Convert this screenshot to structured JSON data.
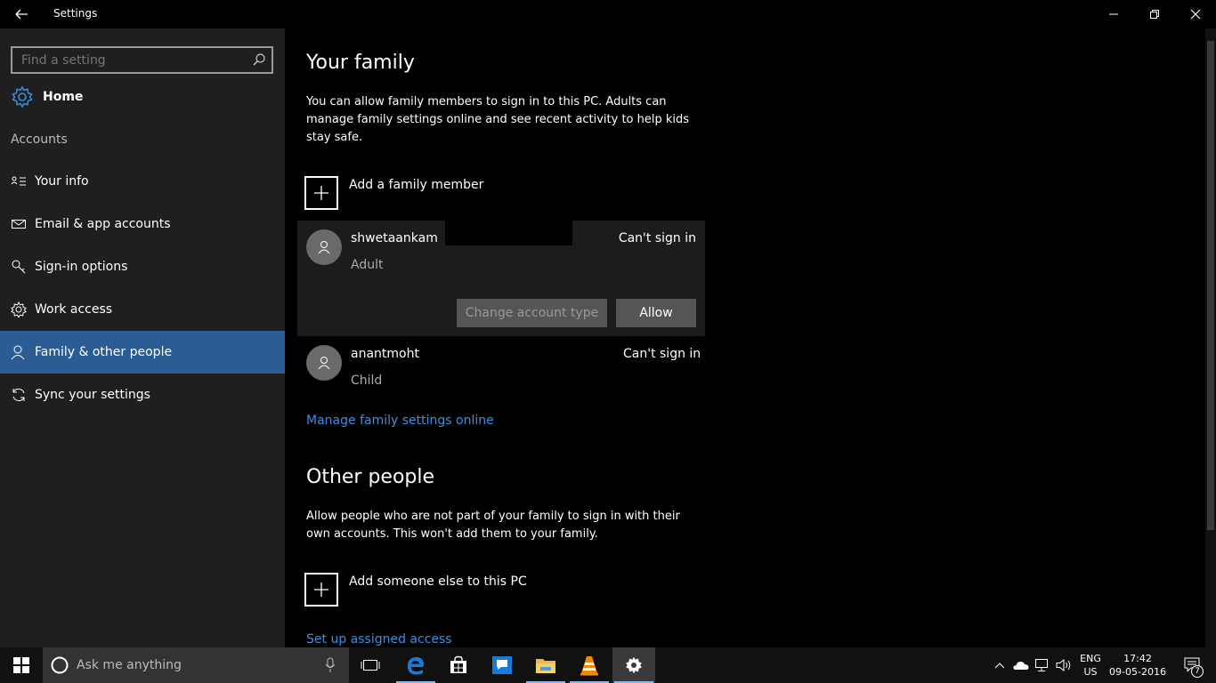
{
  "window": {
    "title": "Settings"
  },
  "sidebar": {
    "search_placeholder": "Find a setting",
    "home_label": "Home",
    "section_label": "Accounts",
    "items": [
      {
        "label": "Your info",
        "icon": "contact-card-icon"
      },
      {
        "label": "Email & app accounts",
        "icon": "mail-icon"
      },
      {
        "label": "Sign-in options",
        "icon": "key-icon"
      },
      {
        "label": "Work access",
        "icon": "briefcase-gear-icon"
      },
      {
        "label": "Family & other people",
        "icon": "person-icon",
        "active": true
      },
      {
        "label": "Sync your settings",
        "icon": "sync-icon"
      }
    ]
  },
  "family": {
    "heading": "Your family",
    "description": "You can allow family members to sign in to this PC. Adults can manage family settings online and see recent activity to help kids stay safe.",
    "add_label": "Add a family member",
    "members": [
      {
        "name": "shwetaankam",
        "role": "Adult",
        "status": "Can't sign in"
      },
      {
        "name": "anantmoht",
        "role": "Child",
        "status": "Can't sign in"
      }
    ],
    "change_type_label": "Change account type",
    "allow_label": "Allow",
    "manage_link": "Manage family settings online"
  },
  "other": {
    "heading": "Other people",
    "description": "Allow people who are not part of your family to sign in with their own accounts. This won't add them to your family.",
    "add_label": "Add someone else to this PC",
    "assigned_link": "Set up assigned access"
  },
  "taskbar": {
    "cortana_placeholder": "Ask me anything",
    "lang": "ENG",
    "region": "US",
    "time": "17:42",
    "date": "09-05-2016",
    "notification_count": "7"
  },
  "colors": {
    "accent": "#2b5c94",
    "link": "#3b8fe0"
  }
}
